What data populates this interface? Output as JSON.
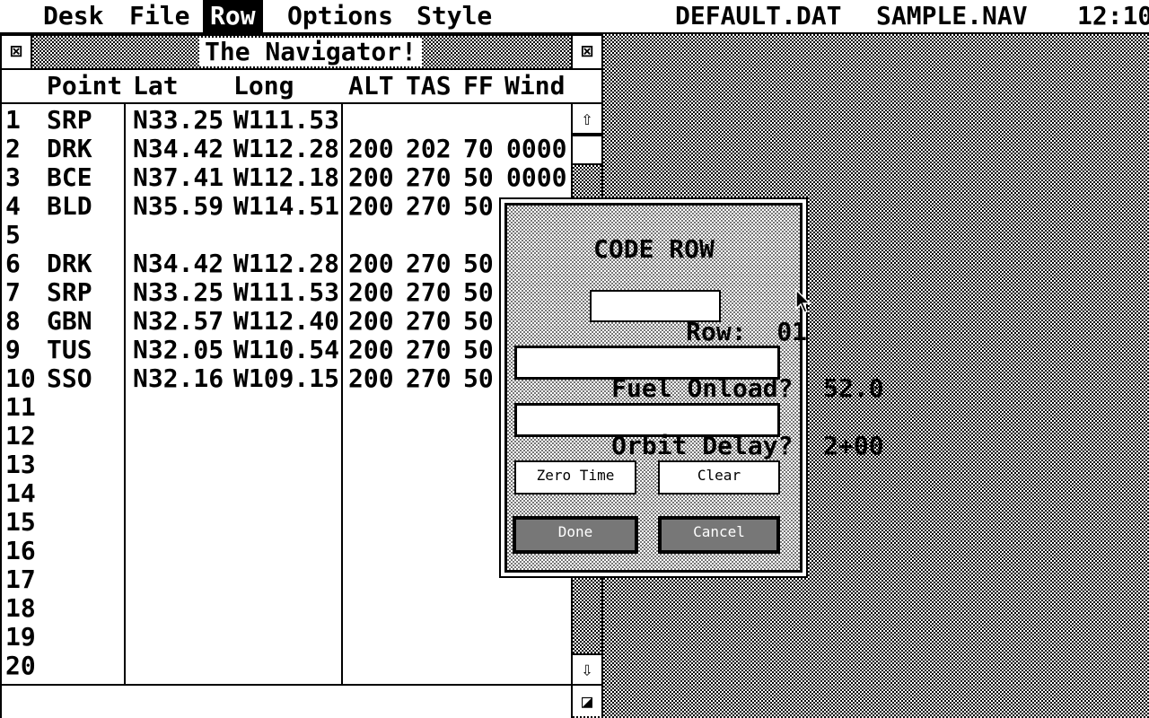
{
  "menubar": {
    "items": [
      {
        "label": "Desk",
        "active": false
      },
      {
        "label": "File",
        "active": false
      },
      {
        "label": "Row",
        "active": true
      },
      {
        "label": "Options",
        "active": false
      },
      {
        "label": "Style",
        "active": false
      }
    ],
    "file1": "DEFAULT.DAT",
    "file2": "SAMPLE.NAV",
    "clock": "12:10"
  },
  "window": {
    "title": "The Navigator!",
    "close_glyph": "⊠",
    "full_glyph": "⊠",
    "columns": [
      "Point",
      "Lat",
      "Long",
      "ALT",
      "TAS",
      "FF",
      "Wind"
    ],
    "rows": [
      {
        "n": "1",
        "point": "SRP",
        "lat": "N33.25",
        "long": "W111.53",
        "alt": "",
        "tas": "",
        "ff": "",
        "wind": ""
      },
      {
        "n": "2",
        "point": "DRK",
        "lat": "N34.42",
        "long": "W112.28",
        "alt": "200",
        "tas": "202",
        "ff": "70",
        "wind": "0000"
      },
      {
        "n": "3",
        "point": "BCE",
        "lat": "N37.41",
        "long": "W112.18",
        "alt": "200",
        "tas": "270",
        "ff": "50",
        "wind": "0000"
      },
      {
        "n": "4",
        "point": "BLD",
        "lat": "N35.59",
        "long": "W114.51",
        "alt": "200",
        "tas": "270",
        "ff": "50",
        "wind": ""
      },
      {
        "n": "5",
        "point": "",
        "lat": "",
        "long": "",
        "alt": "",
        "tas": "",
        "ff": "",
        "wind": ""
      },
      {
        "n": "6",
        "point": "DRK",
        "lat": "N34.42",
        "long": "W112.28",
        "alt": "200",
        "tas": "270",
        "ff": "50",
        "wind": ""
      },
      {
        "n": "7",
        "point": "SRP",
        "lat": "N33.25",
        "long": "W111.53",
        "alt": "200",
        "tas": "270",
        "ff": "50",
        "wind": ""
      },
      {
        "n": "8",
        "point": "GBN",
        "lat": "N32.57",
        "long": "W112.40",
        "alt": "200",
        "tas": "270",
        "ff": "50",
        "wind": ""
      },
      {
        "n": "9",
        "point": "TUS",
        "lat": "N32.05",
        "long": "W110.54",
        "alt": "200",
        "tas": "270",
        "ff": "50",
        "wind": ""
      },
      {
        "n": "10",
        "point": "SSO",
        "lat": "N32.16",
        "long": "W109.15",
        "alt": "200",
        "tas": "270",
        "ff": "50",
        "wind": ""
      },
      {
        "n": "11",
        "point": "",
        "lat": "",
        "long": "",
        "alt": "",
        "tas": "",
        "ff": "",
        "wind": ""
      },
      {
        "n": "12",
        "point": "",
        "lat": "",
        "long": "",
        "alt": "",
        "tas": "",
        "ff": "",
        "wind": ""
      },
      {
        "n": "13",
        "point": "",
        "lat": "",
        "long": "",
        "alt": "",
        "tas": "",
        "ff": "",
        "wind": ""
      },
      {
        "n": "14",
        "point": "",
        "lat": "",
        "long": "",
        "alt": "",
        "tas": "",
        "ff": "",
        "wind": ""
      },
      {
        "n": "15",
        "point": "",
        "lat": "",
        "long": "",
        "alt": "",
        "tas": "",
        "ff": "",
        "wind": ""
      },
      {
        "n": "16",
        "point": "",
        "lat": "",
        "long": "",
        "alt": "",
        "tas": "",
        "ff": "",
        "wind": ""
      },
      {
        "n": "17",
        "point": "",
        "lat": "",
        "long": "",
        "alt": "",
        "tas": "",
        "ff": "",
        "wind": ""
      },
      {
        "n": "18",
        "point": "",
        "lat": "",
        "long": "",
        "alt": "",
        "tas": "",
        "ff": "",
        "wind": ""
      },
      {
        "n": "19",
        "point": "",
        "lat": "",
        "long": "",
        "alt": "",
        "tas": "",
        "ff": "",
        "wind": ""
      },
      {
        "n": "20",
        "point": "",
        "lat": "",
        "long": "",
        "alt": "",
        "tas": "",
        "ff": "",
        "wind": ""
      }
    ],
    "scroll_up_glyph": "⇧",
    "scroll_down_glyph": "⇩",
    "resize_glyph": "◪"
  },
  "dialog": {
    "title": "CODE ROW",
    "row_label": "Row:",
    "row_value": "01",
    "fuel_label": "Fuel Onload?",
    "fuel_value": "52.0",
    "orbit_label": "Orbit Delay?",
    "orbit_value": "2+00",
    "zero_time_label": "Zero Time",
    "clear_label": "Clear",
    "done_label": "Done",
    "cancel_label": "Cancel"
  }
}
